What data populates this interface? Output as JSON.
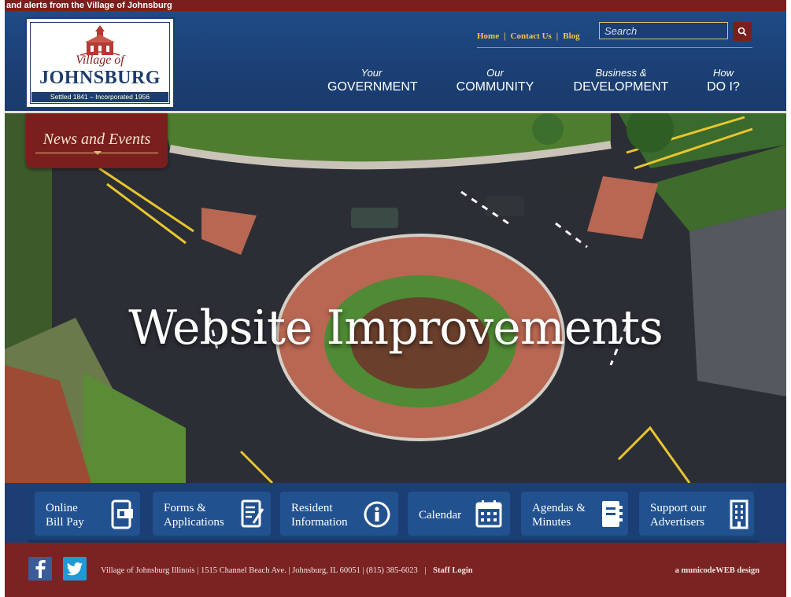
{
  "ticker": {
    "text": "and alerts from the Village of Johnsburg"
  },
  "logo": {
    "village_line": "Village of",
    "name": "JOHNSBURG",
    "tagline": "Settled 1841 – Incorporated 1956"
  },
  "utility_nav": {
    "home": "Home",
    "contact": "Contact Us",
    "blog": "Blog",
    "separator": "|"
  },
  "search": {
    "placeholder": "Search"
  },
  "main_nav": [
    {
      "small": "Your",
      "big": "GOVERNMENT"
    },
    {
      "small": "Our",
      "big": "COMMUNITY"
    },
    {
      "small": "Business &",
      "big": "DEVELOPMENT"
    },
    {
      "small": "How",
      "big": "DO I?"
    }
  ],
  "news_tab": {
    "label": "News and Events"
  },
  "hero": {
    "title": "Website Improvements"
  },
  "quick_links": [
    {
      "line1": "Online",
      "line2": "Bill Pay",
      "icon": "bill-pay-icon"
    },
    {
      "line1": "Forms &",
      "line2": "Applications",
      "icon": "forms-icon"
    },
    {
      "line1": "Resident",
      "line2": "Information",
      "icon": "info-icon"
    },
    {
      "line1": "Calendar",
      "line2": "",
      "icon": "calendar-icon"
    },
    {
      "line1": "Agendas &",
      "line2": "Minutes",
      "icon": "notebook-icon"
    },
    {
      "line1": "Support our",
      "line2": "Advertisers",
      "icon": "building-icon"
    }
  ],
  "footer": {
    "address": "Village of Johnsburg Illinois | 1515 Channel Beach Ave. | Johnsburg, IL 60051 | (815) 385-6023",
    "separator": "|",
    "staff_login": "Staff Login",
    "credit": "a municodeWEB design"
  },
  "colors": {
    "header_blue": "#1b3f74",
    "maroon": "#7a1f1e",
    "gold": "#f2c84a",
    "facebook": "#3b5c9b",
    "twitter": "#1f9ad6"
  }
}
